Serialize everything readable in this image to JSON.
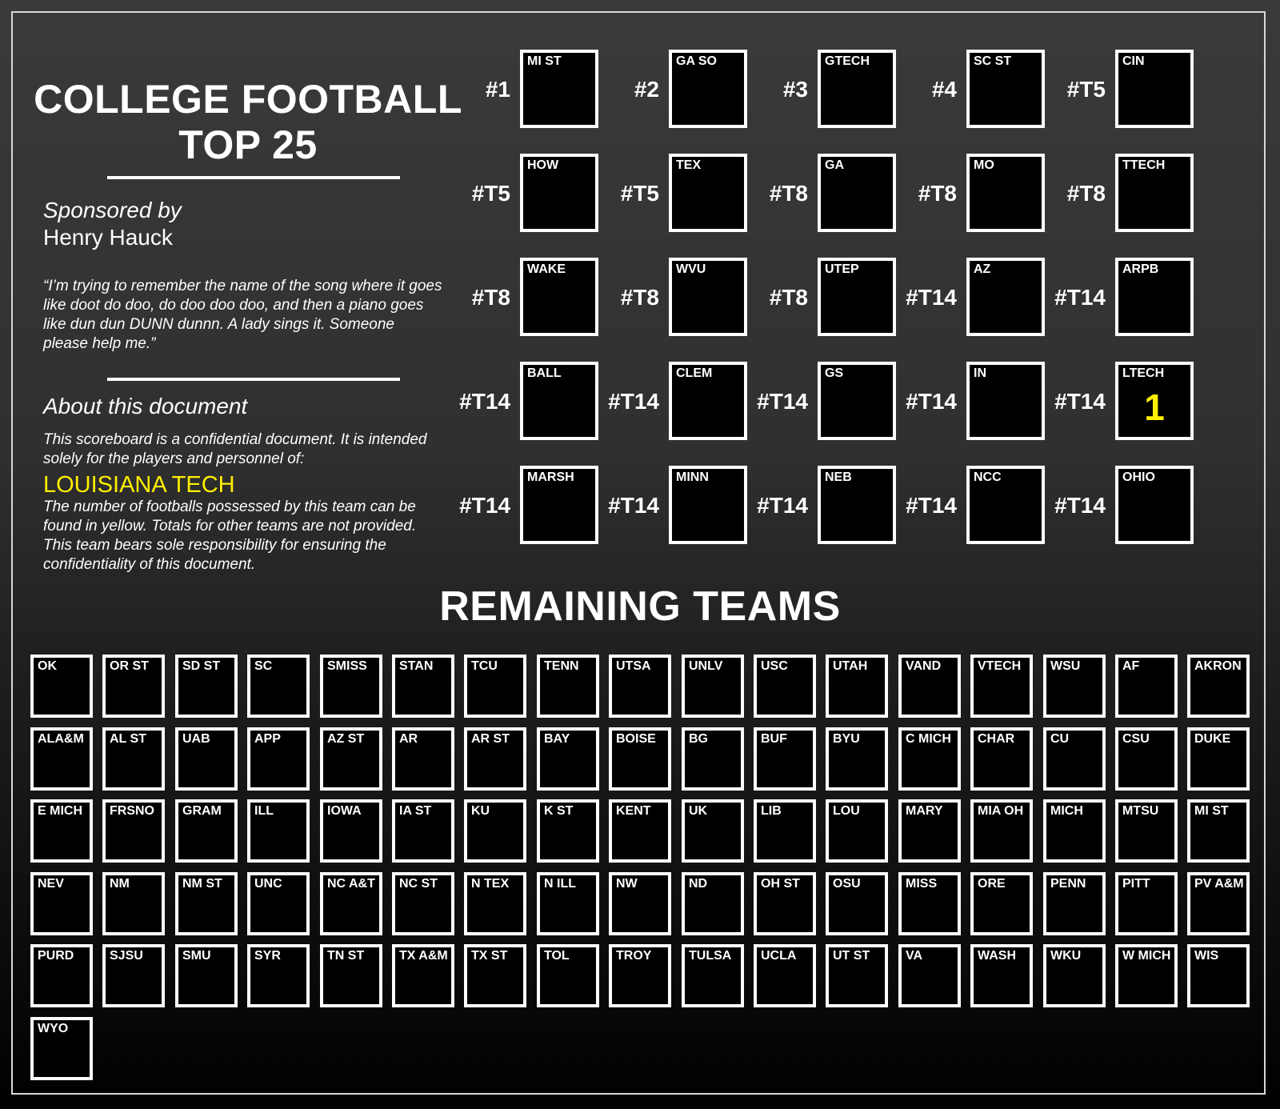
{
  "header": {
    "title_line1": "COLLEGE FOOTBALL",
    "title_line2": "TOP 25",
    "sponsor_label": "Sponsored by",
    "sponsor_name": "Henry Hauck",
    "quote": "“I’m trying to remember the name of the song where it goes like doot do doo, do doo doo doo, and then a piano goes like dun dun DUNN dunnn. A lady sings it. Someone please help me.”",
    "about_heading": "About this document",
    "about_intro": "This scoreboard is a confidential document. It is intended solely for the players and personnel of:",
    "team_name": "LOUISIANA TECH",
    "about_body": "The number of footballs possessed by this team can be found in yellow. Totals for other teams are not provided. This team bears sole responsibility for ensuring the confidentiality of this document."
  },
  "top25": [
    {
      "rank": "#1",
      "team": "MI ST",
      "count": ""
    },
    {
      "rank": "#2",
      "team": "GA SO",
      "count": ""
    },
    {
      "rank": "#3",
      "team": "GTECH",
      "count": ""
    },
    {
      "rank": "#4",
      "team": "SC ST",
      "count": ""
    },
    {
      "rank": "#T5",
      "team": "CIN",
      "count": ""
    },
    {
      "rank": "#T5",
      "team": "HOW",
      "count": ""
    },
    {
      "rank": "#T5",
      "team": "TEX",
      "count": ""
    },
    {
      "rank": "#T8",
      "team": "GA",
      "count": ""
    },
    {
      "rank": "#T8",
      "team": "MO",
      "count": ""
    },
    {
      "rank": "#T8",
      "team": "TTECH",
      "count": ""
    },
    {
      "rank": "#T8",
      "team": "WAKE",
      "count": ""
    },
    {
      "rank": "#T8",
      "team": "WVU",
      "count": ""
    },
    {
      "rank": "#T8",
      "team": "UTEP",
      "count": ""
    },
    {
      "rank": "#T14",
      "team": "AZ",
      "count": ""
    },
    {
      "rank": "#T14",
      "team": "ARPB",
      "count": ""
    },
    {
      "rank": "#T14",
      "team": "BALL",
      "count": ""
    },
    {
      "rank": "#T14",
      "team": "CLEM",
      "count": ""
    },
    {
      "rank": "#T14",
      "team": "GS",
      "count": ""
    },
    {
      "rank": "#T14",
      "team": "IN",
      "count": ""
    },
    {
      "rank": "#T14",
      "team": "LTECH",
      "count": "1"
    },
    {
      "rank": "#T14",
      "team": "MARSH",
      "count": ""
    },
    {
      "rank": "#T14",
      "team": "MINN",
      "count": ""
    },
    {
      "rank": "#T14",
      "team": "NEB",
      "count": ""
    },
    {
      "rank": "#T14",
      "team": "NCC",
      "count": ""
    },
    {
      "rank": "#T14",
      "team": "OHIO",
      "count": ""
    }
  ],
  "remaining_heading": "REMAINING TEAMS",
  "remaining": [
    "OK",
    "OR ST",
    "SD ST",
    "SC",
    "SMISS",
    "STAN",
    "TCU",
    "TENN",
    "UTSA",
    "UNLV",
    "USC",
    "UTAH",
    "VAND",
    "VTECH",
    "WSU",
    "AF",
    "AKRON",
    "ALA&M",
    "AL ST",
    "UAB",
    "APP",
    "AZ ST",
    "AR",
    "AR ST",
    "BAY",
    "BOISE",
    "BG",
    "BUF",
    "BYU",
    "C MICH",
    "CHAR",
    "CU",
    "CSU",
    "DUKE",
    "E MICH",
    "FRSNO",
    "GRAM",
    "ILL",
    "IOWA",
    "IA ST",
    "KU",
    "K ST",
    "KENT",
    "UK",
    "LIB",
    "LOU",
    "MARY",
    "MIA OH",
    "MICH",
    "MTSU",
    "MI ST",
    "NEV",
    "NM",
    "NM ST",
    "UNC",
    "NC A&T",
    "NC ST",
    "N TEX",
    "N ILL",
    "NW",
    "ND",
    "OH ST",
    "OSU",
    "MISS",
    "ORE",
    "PENN",
    "PITT",
    "PV A&M",
    "PURD",
    "SJSU",
    "SMU",
    "SYR",
    "TN ST",
    "TX A&M",
    "TX ST",
    "TOL",
    "TROY",
    "TULSA",
    "UCLA",
    "UT ST",
    "VA",
    "WASH",
    "WKU",
    "W MICH",
    "WIS",
    "WYO"
  ],
  "colors": {
    "highlight": "#ffef00",
    "box_border": "#ffffff",
    "box_fill": "#000000"
  }
}
